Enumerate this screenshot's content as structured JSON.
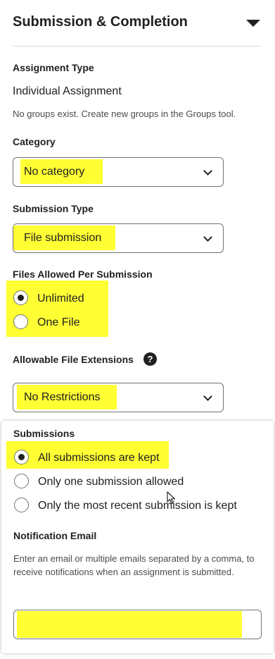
{
  "section": {
    "title": "Submission & Completion"
  },
  "assignment_type": {
    "label": "Assignment Type",
    "value": "Individual Assignment",
    "note": "No groups exist. Create new groups in the Groups tool."
  },
  "category": {
    "label": "Category",
    "selected": "No category"
  },
  "submission_type": {
    "label": "Submission Type",
    "selected": "File submission"
  },
  "files_allowed": {
    "label": "Files Allowed Per Submission",
    "options": [
      {
        "label": "Unlimited",
        "checked": true
      },
      {
        "label": "One File",
        "checked": false
      }
    ]
  },
  "file_extensions": {
    "label": "Allowable File Extensions",
    "selected": "No Restrictions",
    "help_icon": "question-circle-icon"
  },
  "submissions": {
    "label": "Submissions",
    "options": [
      {
        "label": "All submissions are kept",
        "checked": true
      },
      {
        "label": "Only one submission allowed",
        "checked": false
      },
      {
        "label": "Only the most recent submission is kept",
        "checked": false
      }
    ]
  },
  "notification_email": {
    "label": "Notification Email",
    "description": "Enter an email or multiple emails separated by a comma, to receive notifications when an assignment is submitted.",
    "value": ""
  },
  "colors": {
    "highlight": "#ffff33",
    "text": "#202122",
    "border": "#6e7477"
  }
}
